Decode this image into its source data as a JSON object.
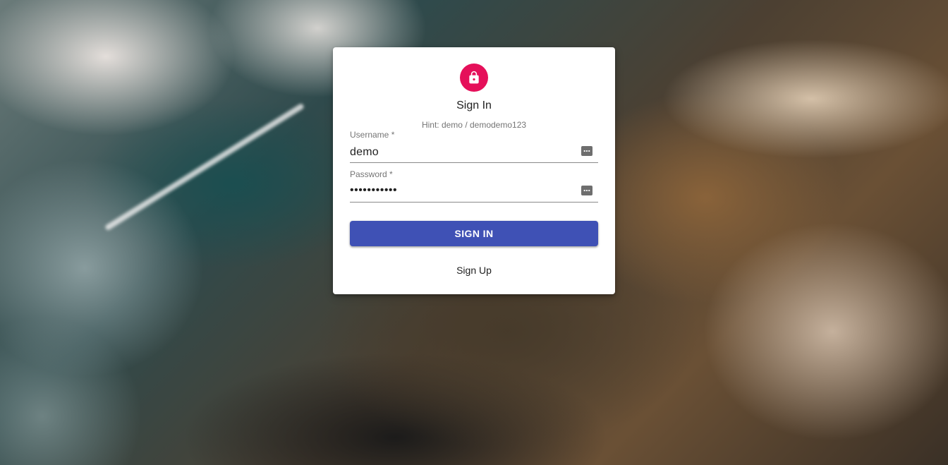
{
  "login": {
    "title": "Sign In",
    "hint": "Hint: demo / demodemo123",
    "username": {
      "label": "Username *",
      "value": "demo"
    },
    "password": {
      "label": "Password *",
      "value": "•••••••••••"
    },
    "signin_label": "SIGN IN",
    "signup_label": "Sign Up"
  },
  "colors": {
    "avatar": "#e5105a",
    "primary_button": "#3f51b5"
  },
  "icons": {
    "avatar": "lock-icon",
    "username_field": "password-manager-icon",
    "password_field": "password-manager-icon"
  }
}
